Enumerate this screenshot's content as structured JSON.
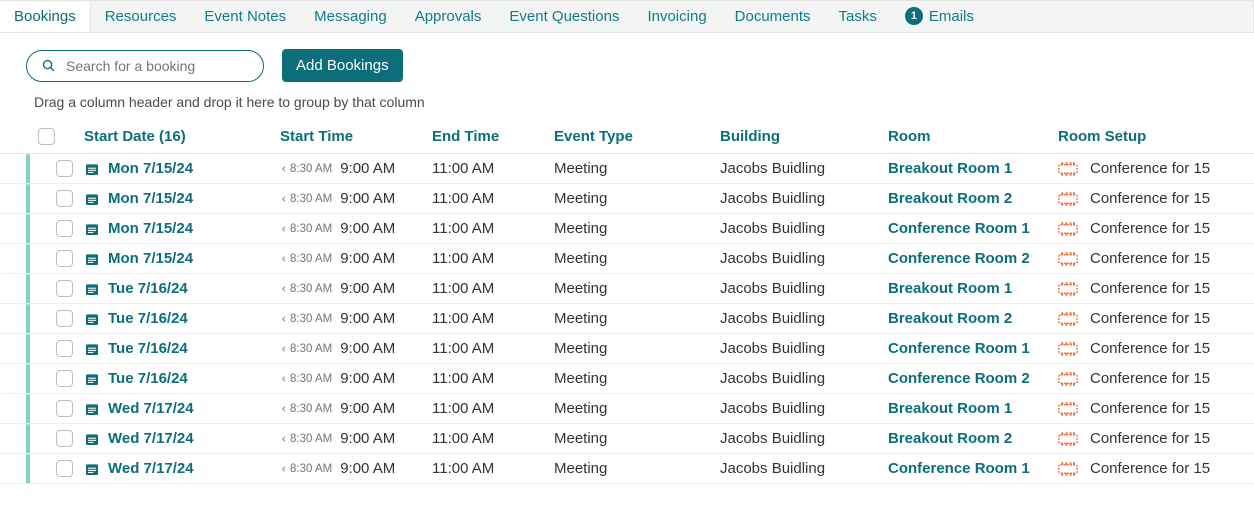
{
  "tabs": [
    {
      "label": "Bookings",
      "active": true,
      "badge": null
    },
    {
      "label": "Resources",
      "active": false,
      "badge": null
    },
    {
      "label": "Event Notes",
      "active": false,
      "badge": null
    },
    {
      "label": "Messaging",
      "active": false,
      "badge": null
    },
    {
      "label": "Approvals",
      "active": false,
      "badge": null
    },
    {
      "label": "Event Questions",
      "active": false,
      "badge": null
    },
    {
      "label": "Invoicing",
      "active": false,
      "badge": null
    },
    {
      "label": "Documents",
      "active": false,
      "badge": null
    },
    {
      "label": "Tasks",
      "active": false,
      "badge": null
    },
    {
      "label": "Emails",
      "active": false,
      "badge": "1"
    }
  ],
  "search": {
    "placeholder": "Search for a booking"
  },
  "add_bookings_label": "Add Bookings",
  "group_hint": "Drag a column header and drop it here to group by that column",
  "columns": {
    "start_date": "Start Date (16)",
    "start_time": "Start Time",
    "end_time": "End Time",
    "event_type": "Event Type",
    "building": "Building",
    "room": "Room",
    "room_setup": "Room Setup"
  },
  "rows": [
    {
      "start_date": "Mon 7/15/24",
      "early": "8:30 AM",
      "start_time": "9:00 AM",
      "end_time": "11:00 AM",
      "event_type": "Meeting",
      "building": "Jacobs Buidling",
      "room": "Breakout Room 1",
      "setup": "Conference for 15"
    },
    {
      "start_date": "Mon 7/15/24",
      "early": "8:30 AM",
      "start_time": "9:00 AM",
      "end_time": "11:00 AM",
      "event_type": "Meeting",
      "building": "Jacobs Buidling",
      "room": "Breakout Room 2",
      "setup": "Conference for 15"
    },
    {
      "start_date": "Mon 7/15/24",
      "early": "8:30 AM",
      "start_time": "9:00 AM",
      "end_time": "11:00 AM",
      "event_type": "Meeting",
      "building": "Jacobs Buidling",
      "room": "Conference Room 1",
      "setup": "Conference for 15"
    },
    {
      "start_date": "Mon 7/15/24",
      "early": "8:30 AM",
      "start_time": "9:00 AM",
      "end_time": "11:00 AM",
      "event_type": "Meeting",
      "building": "Jacobs Buidling",
      "room": "Conference Room 2",
      "setup": "Conference for 15"
    },
    {
      "start_date": "Tue 7/16/24",
      "early": "8:30 AM",
      "start_time": "9:00 AM",
      "end_time": "11:00 AM",
      "event_type": "Meeting",
      "building": "Jacobs Buidling",
      "room": "Breakout Room 1",
      "setup": "Conference for 15"
    },
    {
      "start_date": "Tue 7/16/24",
      "early": "8:30 AM",
      "start_time": "9:00 AM",
      "end_time": "11:00 AM",
      "event_type": "Meeting",
      "building": "Jacobs Buidling",
      "room": "Breakout Room 2",
      "setup": "Conference for 15"
    },
    {
      "start_date": "Tue 7/16/24",
      "early": "8:30 AM",
      "start_time": "9:00 AM",
      "end_time": "11:00 AM",
      "event_type": "Meeting",
      "building": "Jacobs Buidling",
      "room": "Conference Room 1",
      "setup": "Conference for 15"
    },
    {
      "start_date": "Tue 7/16/24",
      "early": "8:30 AM",
      "start_time": "9:00 AM",
      "end_time": "11:00 AM",
      "event_type": "Meeting",
      "building": "Jacobs Buidling",
      "room": "Conference Room 2",
      "setup": "Conference for 15"
    },
    {
      "start_date": "Wed 7/17/24",
      "early": "8:30 AM",
      "start_time": "9:00 AM",
      "end_time": "11:00 AM",
      "event_type": "Meeting",
      "building": "Jacobs Buidling",
      "room": "Breakout Room 1",
      "setup": "Conference for 15"
    },
    {
      "start_date": "Wed 7/17/24",
      "early": "8:30 AM",
      "start_time": "9:00 AM",
      "end_time": "11:00 AM",
      "event_type": "Meeting",
      "building": "Jacobs Buidling",
      "room": "Breakout Room 2",
      "setup": "Conference for 15"
    },
    {
      "start_date": "Wed 7/17/24",
      "early": "8:30 AM",
      "start_time": "9:00 AM",
      "end_time": "11:00 AM",
      "event_type": "Meeting",
      "building": "Jacobs Buidling",
      "room": "Conference Room 1",
      "setup": "Conference for 15"
    }
  ]
}
